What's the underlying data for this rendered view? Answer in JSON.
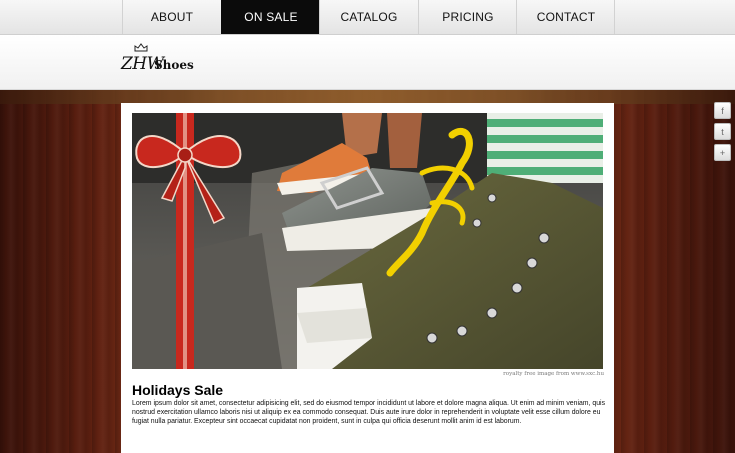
{
  "nav": {
    "items": [
      {
        "label": "ABOUT"
      },
      {
        "label": "ON SALE"
      },
      {
        "label": "CATALOG"
      },
      {
        "label": "PRICING"
      },
      {
        "label": "CONTACT"
      }
    ],
    "active_index": 1
  },
  "logo": {
    "mark": "ZHW",
    "name": "Shoes"
  },
  "social": [
    {
      "icon": "facebook-icon",
      "glyph": "f"
    },
    {
      "icon": "twitter-icon",
      "glyph": "t"
    },
    {
      "icon": "plus-icon",
      "glyph": "+"
    }
  ],
  "hero": {
    "credit": "royalty free image from www.sxc.hu"
  },
  "article": {
    "title": "Holidays Sale",
    "body": "Lorem ipsum dolor sit amet, consectetur adipisicing elit, sed do eiusmod tempor incididunt ut labore et dolore magna aliqua. Ut enim ad minim veniam, quis nostrud exercitation ullamco laboris nisi ut aliquip ex ea commodo consequat. Duis aute irure dolor in reprehenderit in voluptate velit esse cillum dolore eu fugiat nulla pariatur. Excepteur sint occaecat cupidatat non proident, sunt in culpa qui officia deserunt mollit anim id est laborum."
  },
  "colors": {
    "nav_active_bg": "#0b0b0b",
    "ribbon": "#c8281e",
    "wood_dark": "#2b0d07",
    "sneaker_green": "#5b5a34",
    "laces_yellow": "#f2d000"
  }
}
